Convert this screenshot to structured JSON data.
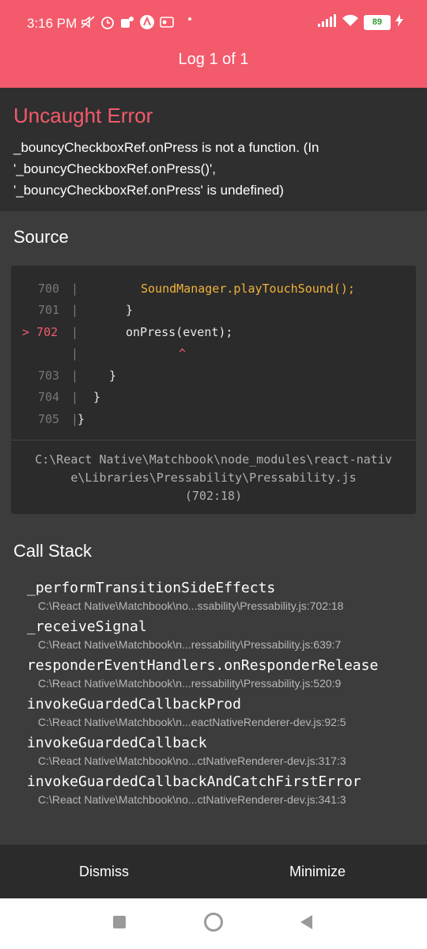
{
  "status": {
    "time": "3:16 PM",
    "battery": "89"
  },
  "header": {
    "title": "Log 1 of 1"
  },
  "error": {
    "title": "Uncaught Error",
    "message": "_bouncyCheckboxRef.onPress is not a function. (In '_bouncyCheckboxRef.onPress()', '_bouncyCheckboxRef.onPress' is undefined)"
  },
  "source": {
    "title": "Source",
    "file": "C:\\React Native\\Matchbook\\node_modules\\react-native\\Libraries\\Pressability\\Pressability.js",
    "position": "(702:18)",
    "lines": [
      {
        "num": "700",
        "code": "SoundManager.playTouchSound();"
      },
      {
        "num": "701",
        "code": "}"
      },
      {
        "num": "> 702",
        "code": "onPress(event);"
      },
      {
        "num": "",
        "code": "^"
      },
      {
        "num": "703",
        "code": "}"
      },
      {
        "num": "704",
        "code": "}"
      },
      {
        "num": "705",
        "code": "}"
      }
    ]
  },
  "callstack": {
    "title": "Call Stack",
    "frames": [
      {
        "name": "_performTransitionSideEffects",
        "location": "C:\\React Native\\Matchbook\\no...ssability\\Pressability.js:702:18"
      },
      {
        "name": "_receiveSignal",
        "location": "C:\\React Native\\Matchbook\\n...ressability\\Pressability.js:639:7"
      },
      {
        "name": "responderEventHandlers.onResponderRelease",
        "location": "C:\\React Native\\Matchbook\\n...ressability\\Pressability.js:520:9"
      },
      {
        "name": "invokeGuardedCallbackProd",
        "location": "C:\\React Native\\Matchbook\\n...eactNativeRenderer-dev.js:92:5"
      },
      {
        "name": "invokeGuardedCallback",
        "location": "C:\\React Native\\Matchbook\\no...ctNativeRenderer-dev.js:317:3"
      },
      {
        "name": "invokeGuardedCallbackAndCatchFirstError",
        "location": "C:\\React Native\\Matchbook\\no...ctNativeRenderer-dev.js:341:3"
      }
    ]
  },
  "footer": {
    "dismiss": "Dismiss",
    "minimize": "Minimize"
  },
  "icons": {
    "status_left": [
      "mute-icon",
      "alarm-icon",
      "teams-icon",
      "app-icon",
      "outlook-icon"
    ],
    "status_right": [
      "signal-icon",
      "wifi-icon",
      "battery-icon",
      "charging-icon"
    ],
    "nav": [
      "recents-icon",
      "home-icon",
      "back-icon"
    ]
  },
  "colors": {
    "accent": "#f35a6b",
    "background": "#3c3c3c",
    "panel": "#2f2f2f"
  }
}
